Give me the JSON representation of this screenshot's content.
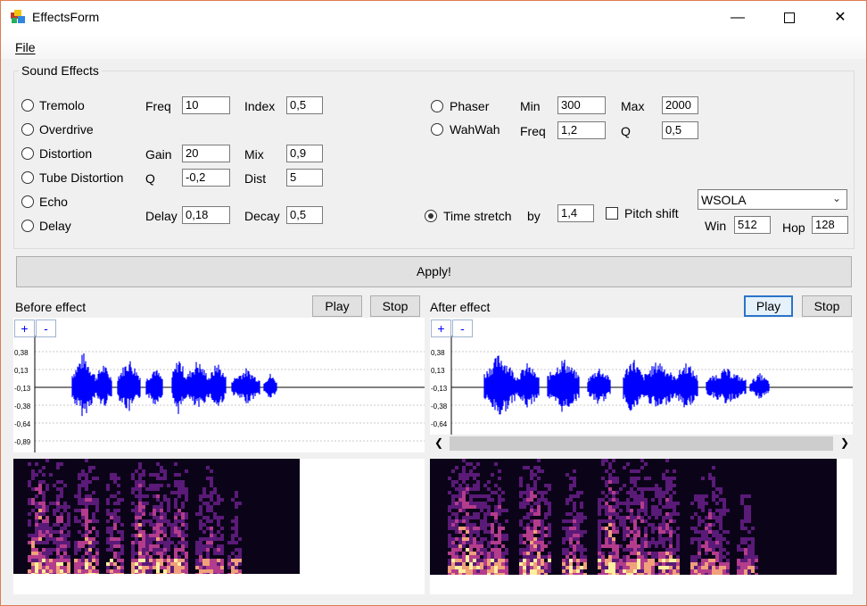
{
  "window": {
    "title": "EffectsForm"
  },
  "menu": {
    "file": "File"
  },
  "group": {
    "title": "Sound Effects",
    "effects": [
      "Tremolo",
      "Overdrive",
      "Distortion",
      "Tube Distortion",
      "Echo",
      "Delay"
    ],
    "labels": {
      "freq": "Freq",
      "index": "Index",
      "gain": "Gain",
      "mix": "Mix",
      "q": "Q",
      "dist": "Dist",
      "delay": "Delay",
      "decay": "Decay",
      "min": "Min",
      "max": "Max",
      "freq2": "Freq",
      "q2": "Q",
      "by": "by",
      "win": "Win",
      "hop": "Hop"
    },
    "values": {
      "freq": "10",
      "index": "0,5",
      "gain": "20",
      "mix": "0,9",
      "q": "-0,2",
      "dist": "5",
      "delay": "0,18",
      "decay": "0,5",
      "min": "300",
      "max": "2000",
      "wah_freq": "1,2",
      "wah_q": "0,5",
      "by": "1,4",
      "win": "512",
      "hop": "128"
    },
    "phaser": "Phaser",
    "wahwah": "WahWah",
    "time_stretch": "Time stretch",
    "time_stretch_checked": true,
    "pitch_shift": "Pitch shift",
    "pitch_shift_checked": false,
    "algorithm": "WSOLA"
  },
  "apply": "Apply!",
  "before": {
    "label": "Before effect",
    "play": "Play",
    "stop": "Stop"
  },
  "after": {
    "label": "After effect",
    "play": "Play",
    "stop": "Stop"
  },
  "zoom": {
    "plus": "+",
    "minus": "-"
  },
  "y_ticks": [
    "0,38",
    "0,13",
    "-0,13",
    "-0,38",
    "-0,64",
    "-0,89"
  ],
  "colors": {
    "waveform": "#0000ff",
    "titlebar_border": "#e07b4f",
    "focus": "#2a74c8"
  },
  "icons": {
    "minimize": "minimize-icon",
    "maximize": "maximize-icon",
    "close": "close-icon"
  }
}
